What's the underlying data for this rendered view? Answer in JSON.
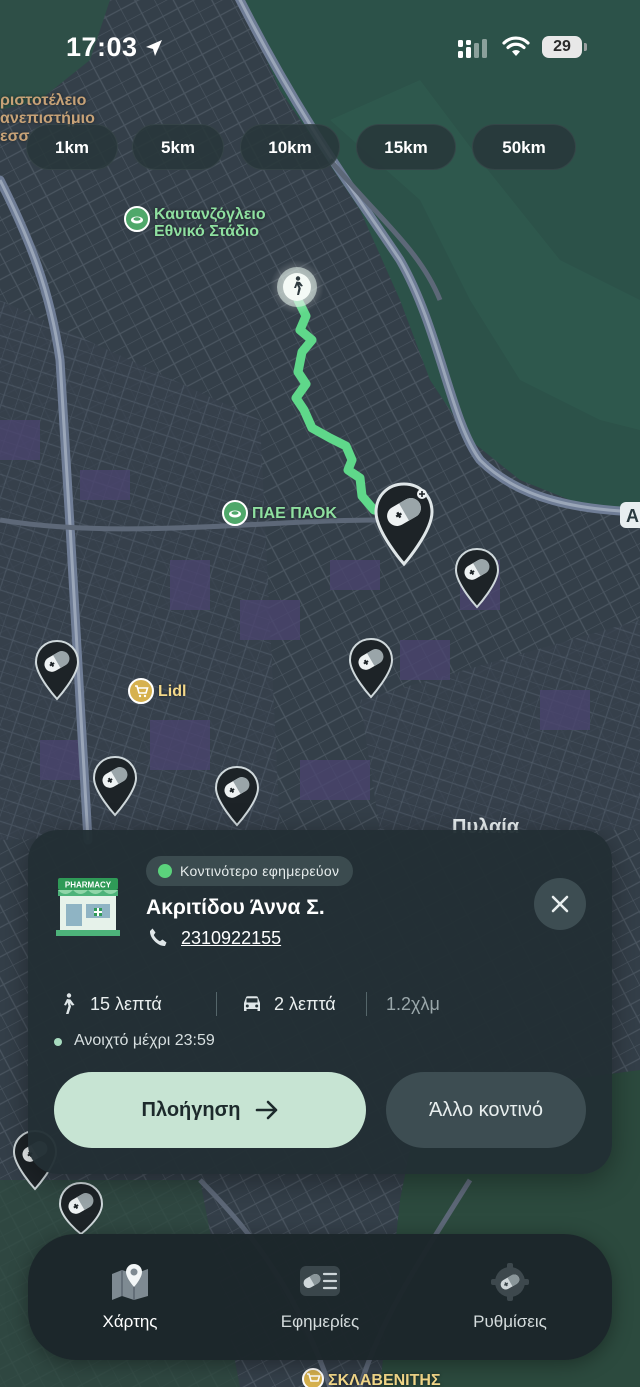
{
  "status_bar": {
    "time": "17:03",
    "battery": "29"
  },
  "distance_chips": [
    {
      "label": "1km"
    },
    {
      "label": "5km"
    },
    {
      "label": "10km"
    },
    {
      "label": "15km"
    },
    {
      "label": "50km"
    }
  ],
  "map": {
    "place_labels": {
      "university": "ριστοτέλειο\nανεπιστήμιο\nεσσ",
      "stadium": "Καυτανζόγλειο\nΕθνικό Στάδιο",
      "paok": "ΠΑΕ ΠΑΟΚ",
      "lidl": "Lidl",
      "area": "Πυλαία",
      "supermarket": "ΣΚΛΑΒΕΝΙΤΗΣ"
    },
    "route_color": "#5fd88a",
    "user_icon": "walking-person-icon",
    "pin_icon": "pharmacy-pill-pin-icon"
  },
  "pharmacy_card": {
    "badge": "Κοντινότερο εφημερεύον",
    "name": "Ακριτίδου Άννα Σ.",
    "phone": "2310922155",
    "walk_time": "15 λεπτά",
    "drive_time": "2 λεπτά",
    "distance": "1.2χλμ",
    "open_status": "Ανοιχτό μέχρι 23:59",
    "navigate_label": "Πλοήγηση",
    "other_label": "Άλλο κοντινό",
    "pharmacy_sign": "PHARMACY"
  },
  "tabs": [
    {
      "label": "Χάρτης",
      "icon": "map-icon",
      "active": true
    },
    {
      "label": "Εφημερίες",
      "icon": "duty-list-icon",
      "active": false
    },
    {
      "label": "Ρυθμίσεις",
      "icon": "settings-gear-icon",
      "active": false
    }
  ],
  "colors": {
    "accent_green": "#5fd88a",
    "card_bg": "#222f34",
    "primary_button": "#c7e4d3"
  }
}
